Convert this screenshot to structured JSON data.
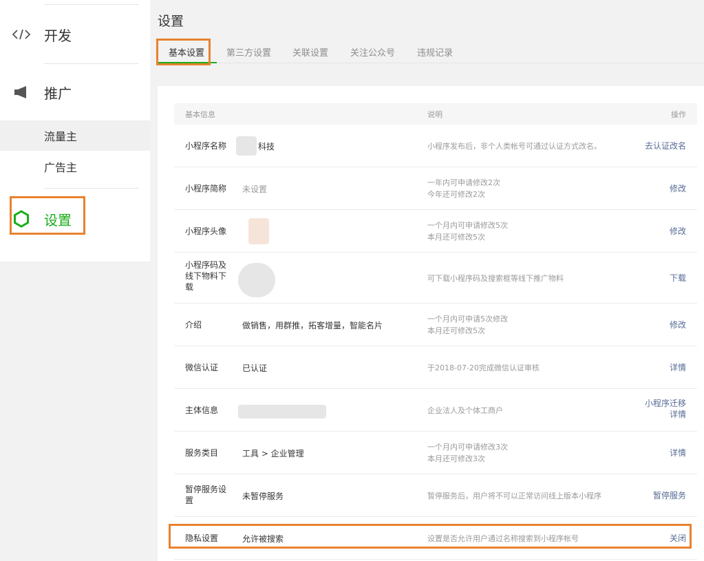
{
  "sidebar": {
    "dev_label": "开发",
    "promote_label": "推广",
    "sub_items": [
      {
        "label": "流量主"
      },
      {
        "label": "广告主"
      }
    ],
    "settings_label": "设置"
  },
  "header": {
    "title": "设置",
    "tabs": [
      {
        "label": "基本设置"
      },
      {
        "label": "第三方设置"
      },
      {
        "label": "关联设置"
      },
      {
        "label": "关注公众号"
      },
      {
        "label": "违规记录"
      }
    ]
  },
  "table": {
    "headers": {
      "info": "基本信息",
      "desc": "说明",
      "action": "操作"
    },
    "rows": [
      {
        "label": "小程序名称",
        "value": "科技",
        "desc": [
          "小程序发布后，非个人类帐号可通过认证方式改名。"
        ],
        "actions": [
          "去认证改名"
        ]
      },
      {
        "label": "小程序简称",
        "value": "未设置",
        "desc": [
          "一年内可申请修改2次",
          "今年还可修改2次"
        ],
        "actions": [
          "修改"
        ]
      },
      {
        "label": "小程序头像",
        "value": "",
        "desc": [
          "一个月内可申请修改5次",
          "本月还可修改5次"
        ],
        "actions": [
          "修改"
        ]
      },
      {
        "label": "小程序码及线下物料下载",
        "value": "",
        "desc": [
          "可下载小程序码及搜索框等线下推广物料"
        ],
        "actions": [
          "下载"
        ]
      },
      {
        "label": "介绍",
        "value": "做销售，用群推，拓客增量，智能名片",
        "desc": [
          "一个月内可申请5次修改",
          "本月还可修改5次"
        ],
        "actions": [
          "修改"
        ]
      },
      {
        "label": "微信认证",
        "value": "已认证",
        "desc": [
          "于2018-07-20完成微信认证审核"
        ],
        "actions": [
          "详情"
        ]
      },
      {
        "label": "主体信息",
        "value": "",
        "desc": [
          "企业法人及个体工商户"
        ],
        "actions": [
          "小程序迁移",
          "详情"
        ]
      },
      {
        "label": "服务类目",
        "value": "工具 > 企业管理",
        "desc": [
          "一个月内可申请修改3次",
          "本月还可修改3次"
        ],
        "actions": [
          "详情"
        ]
      },
      {
        "label": "暂停服务设置",
        "value": "未暂停服务",
        "desc": [
          "暂停服务后，用户将不可以正常访问线上版本小程序"
        ],
        "actions": [
          "暂停服务"
        ]
      },
      {
        "label": "隐私设置",
        "value": "允许被搜索",
        "desc": [
          "设置是否允许用户通过名称搜索到小程序帐号"
        ],
        "actions": [
          "关闭"
        ]
      }
    ]
  },
  "colors": {
    "accent": "#1aad19",
    "link": "#576b95",
    "highlight": "#e8822f"
  }
}
